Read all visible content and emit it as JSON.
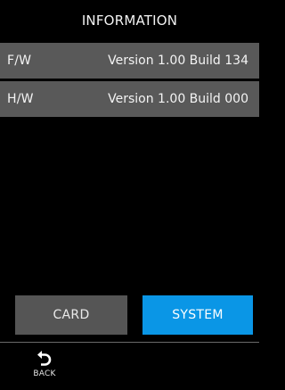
{
  "screen": {
    "title": "INFORMATION"
  },
  "info_rows": [
    {
      "label": "F/W",
      "value": "Version 1.00 Build 134"
    },
    {
      "label": "H/W",
      "value": "Version 1.00 Build 000"
    }
  ],
  "tabs": {
    "card_label": "CARD",
    "system_label": "SYSTEM",
    "active": "SYSTEM"
  },
  "footer": {
    "back_label": "BACK",
    "back_icon": "back-arrow-icon"
  },
  "colors": {
    "background": "#000000",
    "row_background": "#595959",
    "active_tab": "#0a96e6",
    "inactive_tab": "#555555"
  }
}
